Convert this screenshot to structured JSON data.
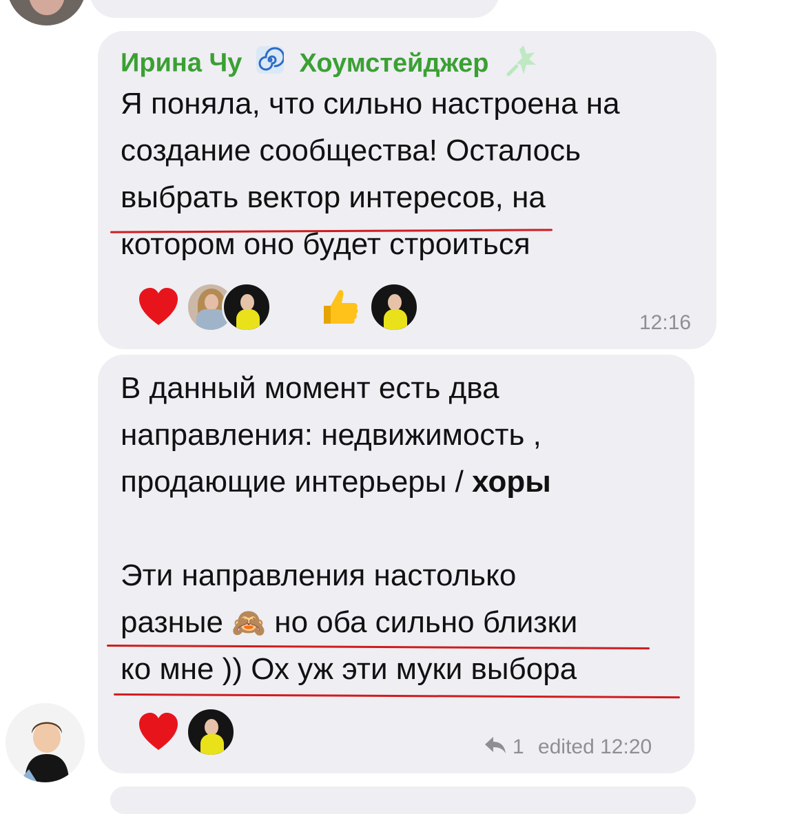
{
  "messages": [
    {
      "sender": "Ирина Чу",
      "role_title": "Хоумстейджер",
      "lines": [
        "Я поняла, что сильно настроена на",
        "создание сообщества! Осталось",
        "выбрать вектор интересов, на",
        "котором оно будет строиться"
      ],
      "reactions": [
        {
          "emoji": "❤️",
          "icon": "heart-icon",
          "users": 2
        },
        {
          "emoji": "👍",
          "icon": "thumbs-up-icon",
          "users": 1
        }
      ],
      "time": "12:16"
    },
    {
      "lines_before_bold": [
        "В данный момент есть два",
        "направления: недвижимость ,",
        "продающие интерьеры / "
      ],
      "bold_word": "хоры",
      "para2": [
        "Эти направления настолько",
        "разные",
        "но оба сильно близки",
        "ко мне )) Ох уж эти муки выбора"
      ],
      "inline_emoji": "🙈",
      "reactions": [
        {
          "emoji": "❤️",
          "icon": "heart-icon",
          "users": 1
        }
      ],
      "reply_count": "1",
      "edited_label": "edited",
      "time": "12:20"
    }
  ],
  "colors": {
    "bubble": "#eeeef3",
    "sender_name": "#3ba033",
    "underline": "#d01c1c",
    "meta": "#8e8e93"
  }
}
